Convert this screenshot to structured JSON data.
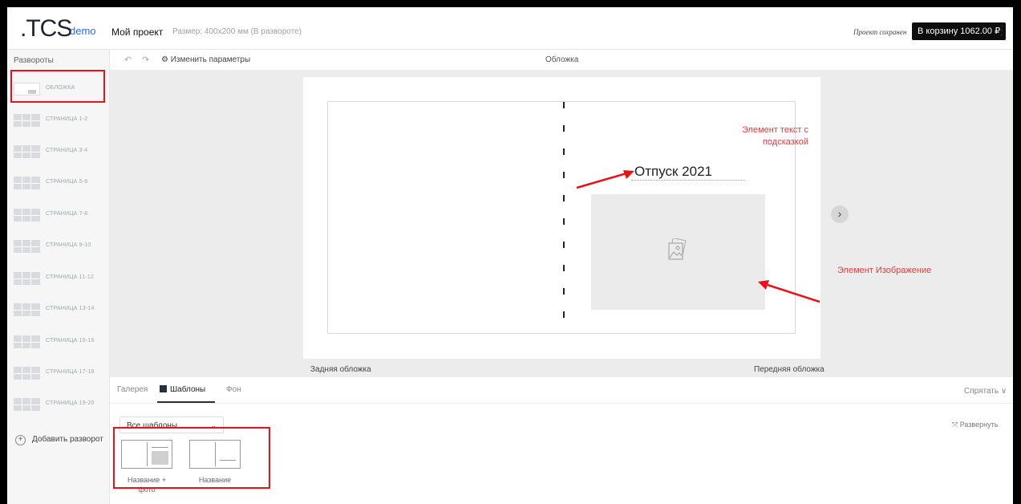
{
  "header": {
    "logo": ".TCS",
    "logo_sub": "demo",
    "project_name": "Мой проект",
    "size_info": "Размер: 400x200 мм (В развороте)",
    "saved_status": "Проект сохранен",
    "cart_button": "В корзину 1062.00 ₽",
    "more_icon": "⋮"
  },
  "sidebar": {
    "title": "Развороты",
    "items": [
      {
        "label": "ОБЛОЖКА"
      },
      {
        "label": "СТРАНИЦА 1-2"
      },
      {
        "label": "СТРАНИЦА 3-4"
      },
      {
        "label": "СТРАНИЦА 5-6"
      },
      {
        "label": "СТРАНИЦА 7-8"
      },
      {
        "label": "СТРАНИЦА 9-10"
      },
      {
        "label": "СТРАНИЦА 11-12"
      },
      {
        "label": "СТРАНИЦА 13-14"
      },
      {
        "label": "СТРАНИЦА 15-16"
      },
      {
        "label": "СТРАНИЦА 17-18"
      },
      {
        "label": "СТРАНИЦА 19-20"
      }
    ],
    "add_spread": "Добавить разворот"
  },
  "toolbar": {
    "undo_icon": "↶",
    "redo_icon": "↷",
    "params_label": "⚙ Изменить параметры",
    "center_title": "Обложка"
  },
  "canvas": {
    "title_text": "Отпуск 2021",
    "back_cover_label": "Задняя обложка",
    "front_cover_label": "Передняя обложка",
    "next_icon": "›"
  },
  "annotations": {
    "text_element": "Элемент текст с подсказкой",
    "image_element": "Элемент Изображение"
  },
  "bottom_panel": {
    "tabs": [
      "Галерея",
      "Шаблоны",
      "Фон"
    ],
    "active_tab": "Шаблоны",
    "hide_label": "Спрятать ∨",
    "expand_label": "⤧ Развернуть",
    "select_value": "Все шаблоны",
    "templates": [
      {
        "label": "Название + фото"
      },
      {
        "label": "Название"
      }
    ]
  },
  "colors": {
    "annotation_red": "#e8131a",
    "brand_blue": "#3366d6",
    "cart_bg": "#0d0d0d"
  }
}
